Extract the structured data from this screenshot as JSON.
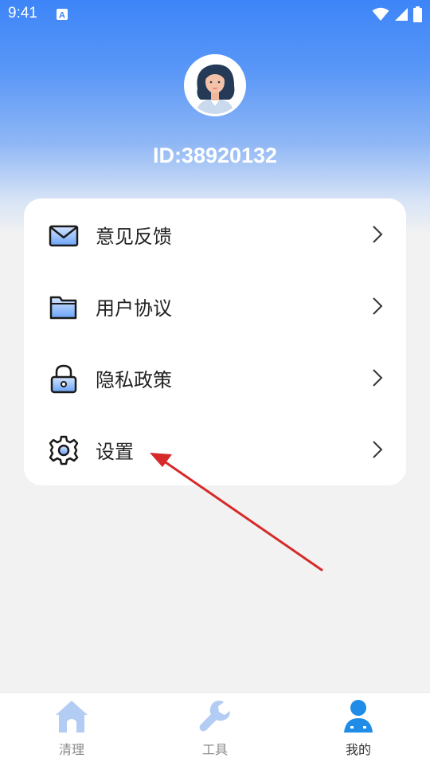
{
  "status_bar": {
    "time": "9:41",
    "notification_icon": "a-square-icon",
    "icons": [
      "wifi-icon",
      "signal-icon",
      "battery-icon"
    ]
  },
  "profile": {
    "avatar_icon": "woman-avatar-icon",
    "id_text": "ID:38920132"
  },
  "menu": {
    "items": [
      {
        "label": "意见反馈",
        "icon": "envelope-icon"
      },
      {
        "label": "用户协议",
        "icon": "folder-icon"
      },
      {
        "label": "隐私政策",
        "icon": "lock-icon"
      },
      {
        "label": "设置",
        "icon": "gear-icon"
      }
    ]
  },
  "tabs": [
    {
      "label": "清理",
      "icon": "home-icon",
      "active": false
    },
    {
      "label": "工具",
      "icon": "wrench-icon",
      "active": false
    },
    {
      "label": "我的",
      "icon": "person-icon",
      "active": true
    }
  ],
  "colors": {
    "header_gradient_top": "#3d85f8",
    "background": "#f2f2f2",
    "tab_active": "#1f8de8",
    "tab_inactive": "#b3ccf3",
    "tab_label_inactive": "#8a8a8a",
    "tab_label_active": "#333333",
    "annotation_arrow": "#d62a2a"
  }
}
